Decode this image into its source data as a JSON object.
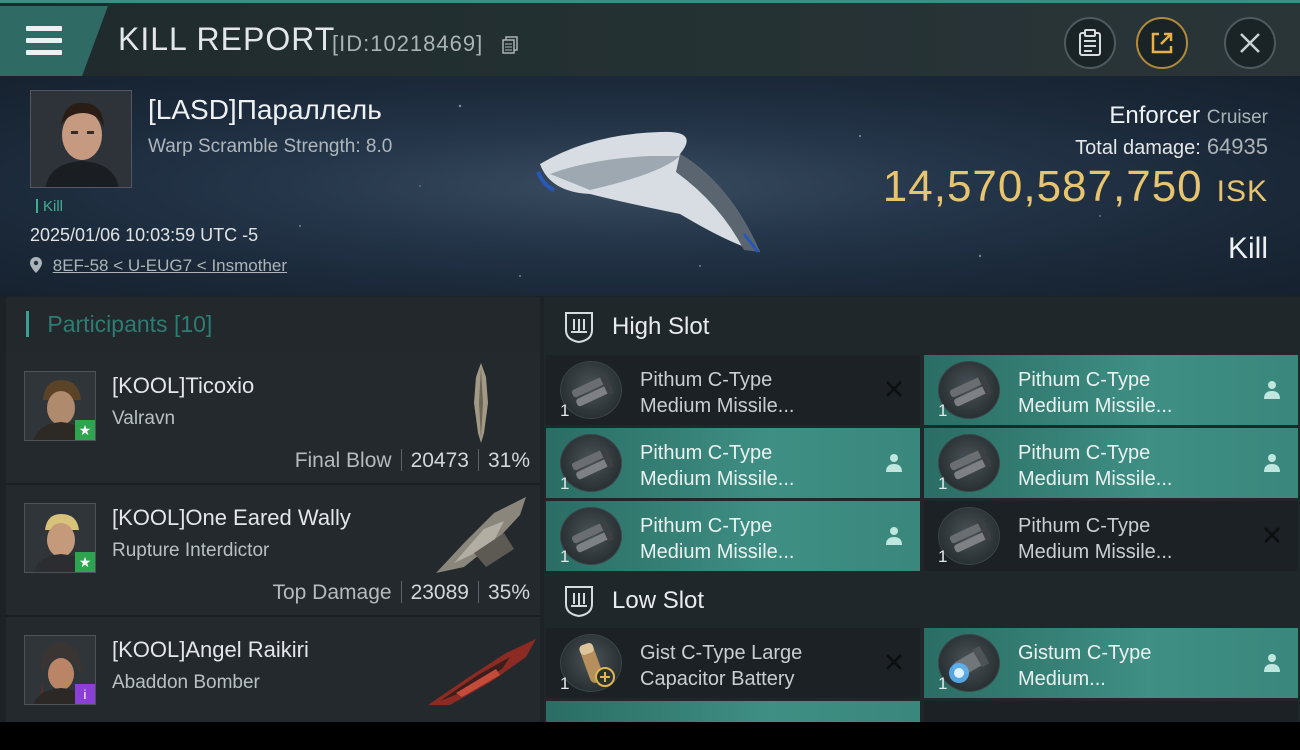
{
  "header": {
    "title": "KILL REPORT",
    "report_id": "[ID:10218469]"
  },
  "victim": {
    "name": "[LASD]Параллель",
    "warp_scramble": "Warp Scramble Strength: 8.0",
    "tag": "Kill",
    "datetime": "2025/01/06 10:03:59 UTC -5",
    "location": "8EF-58 < U-EUG7 < Insmother",
    "ship_name": "Enforcer",
    "ship_class": "Cruiser",
    "total_damage_label": "Total damage:",
    "total_damage": "64935",
    "isk_value": "14,570,587,750",
    "isk_unit": "ISK",
    "result": "Kill"
  },
  "participants": {
    "label": "Participants",
    "count": "[10]",
    "rows": [
      {
        "name": "[KOOL]Ticoxio",
        "ship": "Valravn",
        "role": "Final Blow",
        "damage": "20473",
        "percent": "31%",
        "badge": "green-star"
      },
      {
        "name": "[KOOL]One Eared Wally",
        "ship": "Rupture Interdictor",
        "role": "Top Damage",
        "damage": "23089",
        "percent": "35%",
        "badge": "green-star"
      },
      {
        "name": "[KOOL]Angel Raikiri",
        "ship": "Abaddon Bomber",
        "role": "",
        "damage": "",
        "percent": "",
        "badge": "purple-info"
      }
    ]
  },
  "high_slot": {
    "title": "High Slot",
    "modules": [
      {
        "name1": "Pithum C-Type",
        "name2": "Medium Missile...",
        "qty": "1",
        "status": "destroyed-x-icon",
        "fitted": false
      },
      {
        "name1": "Pithum C-Type",
        "name2": "Medium Missile...",
        "qty": "1",
        "status": "dropped-person-icon",
        "fitted": true
      },
      {
        "name1": "Pithum C-Type",
        "name2": "Medium Missile...",
        "qty": "1",
        "status": "dropped-person-icon",
        "fitted": true
      },
      {
        "name1": "Pithum C-Type",
        "name2": "Medium Missile...",
        "qty": "1",
        "status": "dropped-person-icon",
        "fitted": true
      },
      {
        "name1": "Pithum C-Type",
        "name2": "Medium Missile...",
        "qty": "1",
        "status": "dropped-person-icon",
        "fitted": true
      },
      {
        "name1": "Pithum C-Type",
        "name2": "Medium Missile...",
        "qty": "1",
        "status": "destroyed-x-icon",
        "fitted": false
      }
    ]
  },
  "low_slot": {
    "title": "Low Slot",
    "modules": [
      {
        "name1": "Gist C-Type Large",
        "name2": "Capacitor Battery",
        "qty": "1",
        "status": "destroyed-x-icon",
        "fitted": false
      },
      {
        "name1": "Gistum C-Type",
        "name2": "Medium...",
        "qty": "1",
        "status": "dropped-person-icon",
        "fitted": true
      }
    ]
  },
  "colors": {
    "accent": "#3f8f84",
    "isk_gold": "#e7c46d",
    "panel": "#1b2124"
  }
}
